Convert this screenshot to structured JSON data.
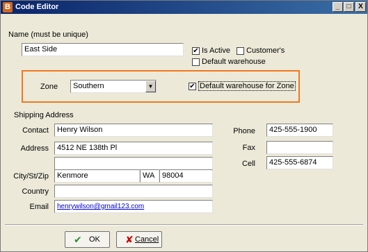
{
  "window": {
    "title": "Code Editor",
    "app_icon_glyph": "B",
    "min": "_",
    "max": "□",
    "close": "X"
  },
  "form": {
    "name_label": "Name (must be unique)",
    "name_value": "East Side",
    "is_active_label": "Is Active",
    "is_active_checked": "✔",
    "customers_label": "Customer's",
    "default_warehouse_label": "Default warehouse",
    "zone_label": "Zone",
    "zone_value": "Southern",
    "zone_arrow": "▼",
    "default_zone_label": "Default warehouse for Zone",
    "default_zone_checked": "✔",
    "shipping_title": "Shipping Address",
    "contact_label": "Contact",
    "contact_value": "Henry Wilson",
    "address_label": "Address",
    "address1_value": "4512 NE 138th Pl",
    "address2_value": "",
    "city_label": "City/St/Zip",
    "city_value": "Kenmore",
    "state_value": "WA",
    "zip_value": "98004",
    "country_label": "Country",
    "country_value": "",
    "email_label": "Email",
    "email_value": "henrywilson@gmail123.com",
    "phone_label": "Phone",
    "phone_value": "425-555-1900",
    "fax_label": "Fax",
    "fax_value": "",
    "cell_label": "Cell",
    "cell_value": "425-555-6874"
  },
  "buttons": {
    "ok_label": "OK",
    "cancel_label": "Cancel"
  },
  "colors": {
    "highlight": "#f07820",
    "ok_check": "#2e8b2e",
    "cancel_x": "#cc0000"
  },
  "icons": {
    "ok": "check-icon",
    "cancel": "x-icon"
  }
}
